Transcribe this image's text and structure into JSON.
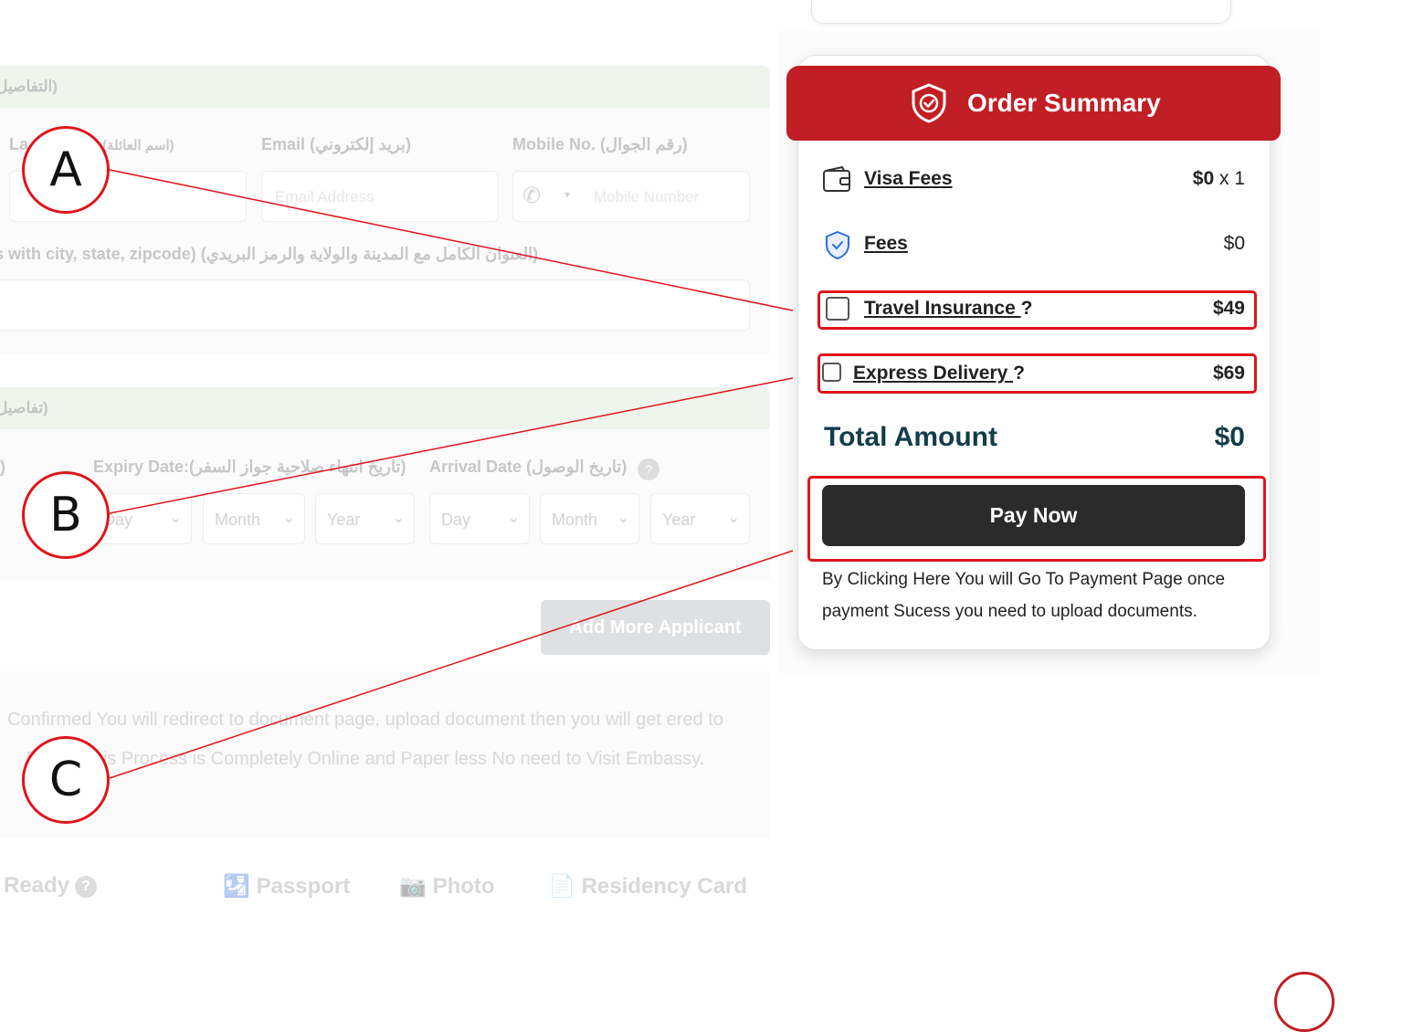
{
  "background_form": {
    "section1_title": "(التفاصيل",
    "fields": {
      "last_name_label": "La",
      "last_name_label_ar": "(اسم العائلة)",
      "email_label": "Email (بريد إلكتروني)",
      "email_placeholder": "Email Address",
      "mobile_label": "Mobile No. (رقم الجوال)",
      "mobile_placeholder": "Mobile Number",
      "address_label": "s with city, state, zipcode) (العنوان الكامل مع المدينة والولاية والرمز البريدي)"
    },
    "section2_title": "(تفاصيل",
    "passport": {
      "left_label_fragment": ")",
      "expiry_label": "Expiry Date:(تاريخ انتهاء صلاحية جواز السفر)",
      "arrival_label": "Arrival Date (تاريخ الوصول)",
      "selects": [
        "Day",
        "Month",
        "Year",
        "Day",
        "Month",
        "Year"
      ]
    },
    "add_more_label": "Add More Applicant",
    "notice_text": "Confirmed You will redirect to document page, upload document then you will get ered to Email. This Process is Completely Online and Paper less No need to Visit Embassy.",
    "docs": {
      "ready_label": "Ready",
      "passport_label": "Passport",
      "photo_label": "Photo",
      "residency_label": "Residency Card"
    }
  },
  "order_summary": {
    "title": "Order Summary",
    "visa_fees": {
      "label": "Visa Fees",
      "amount": "$0",
      "qty": " x 1"
    },
    "fees": {
      "label": "Fees",
      "amount": "$0"
    },
    "travel_insurance": {
      "label": "Travel Insurance ",
      "q": "?",
      "amount": "$49",
      "checked": false
    },
    "express_delivery": {
      "label": "Express Delivery ",
      "q": "?",
      "amount": "$69",
      "checked": false
    },
    "total": {
      "label": "Total Amount",
      "amount": "$0"
    },
    "pay_button": "Pay Now",
    "pay_note": "By Clicking Here You will Go To Payment Page once payment Sucess you need to upload documents."
  },
  "annotations": {
    "a": "A",
    "b": "B",
    "c": "C",
    "color": "#e0141b"
  },
  "colors": {
    "brand_red": "#c11f25",
    "pay_button": "#2b2b2b",
    "total_text": "#123d4a"
  }
}
